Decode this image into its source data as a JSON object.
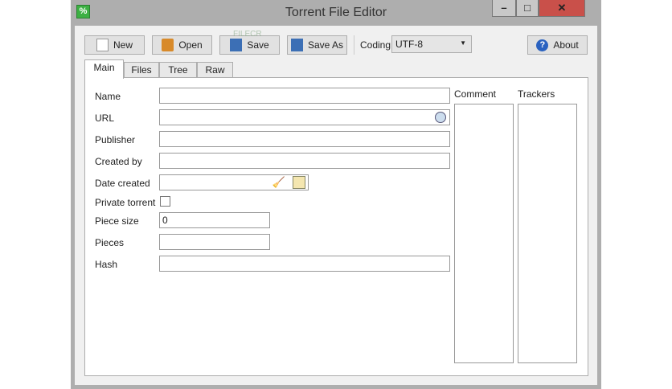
{
  "window": {
    "title": "Torrent File Editor"
  },
  "toolbar": {
    "new": "New",
    "open": "Open",
    "save": "Save",
    "save_as": "Save As",
    "coding_label": "Coding",
    "coding_value": "UTF-8",
    "about": "About"
  },
  "tabs": [
    "Main",
    "Files",
    "Tree",
    "Raw"
  ],
  "fields": {
    "name": "Name",
    "url": "URL",
    "publisher": "Publisher",
    "created_by": "Created by",
    "date_created": "Date created",
    "private_torrent": "Private torrent",
    "piece_size": "Piece size",
    "piece_size_value": "0",
    "pieces": "Pieces",
    "hash": "Hash"
  },
  "side": {
    "comment": "Comment",
    "trackers": "Trackers"
  },
  "watermark": "FILECR"
}
